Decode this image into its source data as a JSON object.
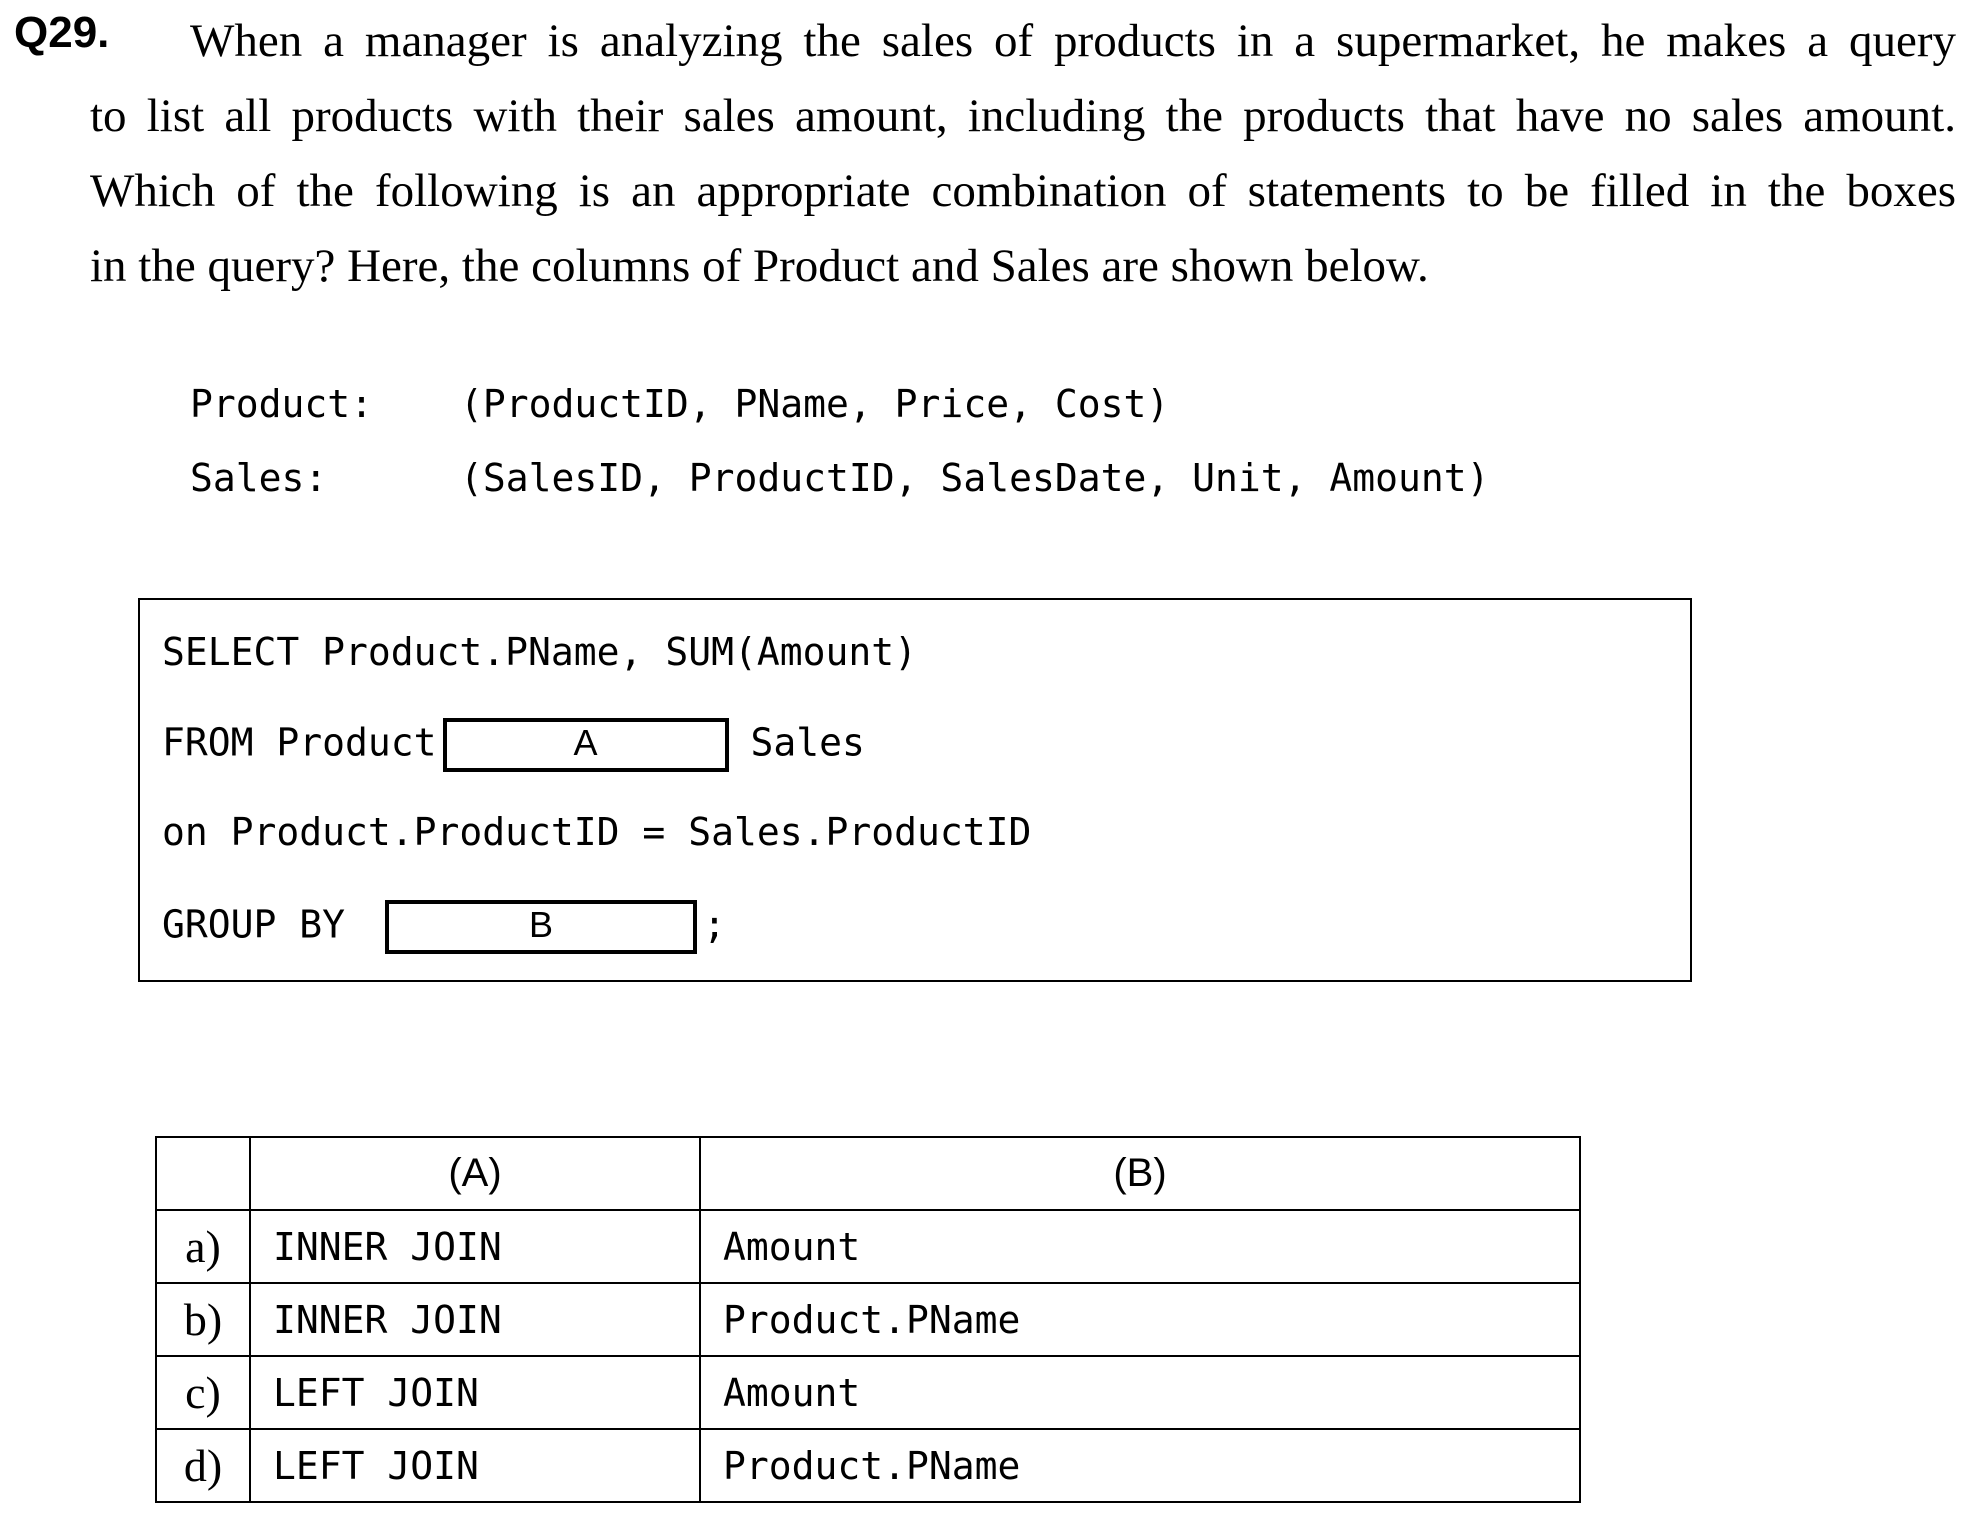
{
  "question": {
    "number": "Q29.",
    "lines": [
      "When a manager is analyzing the sales of products in a supermarket, he makes a query",
      "to list all products with their sales amount, including the products that have no sales amount.",
      "Which of the following is an appropriate combination of statements to be filled in the boxes",
      "in the query? Here, the columns of Product and Sales are shown below."
    ]
  },
  "schema": [
    {
      "name": "Product:",
      "columns": "(ProductID, PName, Price, Cost)"
    },
    {
      "name": "Sales:",
      "columns": "(SalesID, ProductID, SalesDate, Unit, Amount)"
    }
  ],
  "sql": {
    "line1": "SELECT Product.PName, SUM(Amount)",
    "line2_prefix": "FROM Product",
    "blank_a": "A",
    "line2_suffix": "Sales",
    "line3": "on Product.ProductID = Sales.ProductID",
    "line4_prefix": "GROUP BY",
    "blank_b": "B",
    "line4_suffix": ";"
  },
  "answers": {
    "headers": [
      "",
      "(A)",
      "(B)"
    ],
    "rows": [
      {
        "option": "a)",
        "a": "INNER JOIN",
        "b": "Amount"
      },
      {
        "option": "b)",
        "a": "INNER JOIN",
        "b": "Product.PName"
      },
      {
        "option": "c)",
        "a": "LEFT JOIN",
        "b": "Amount"
      },
      {
        "option": "d)",
        "a": "LEFT JOIN",
        "b": "Product.PName"
      }
    ]
  }
}
